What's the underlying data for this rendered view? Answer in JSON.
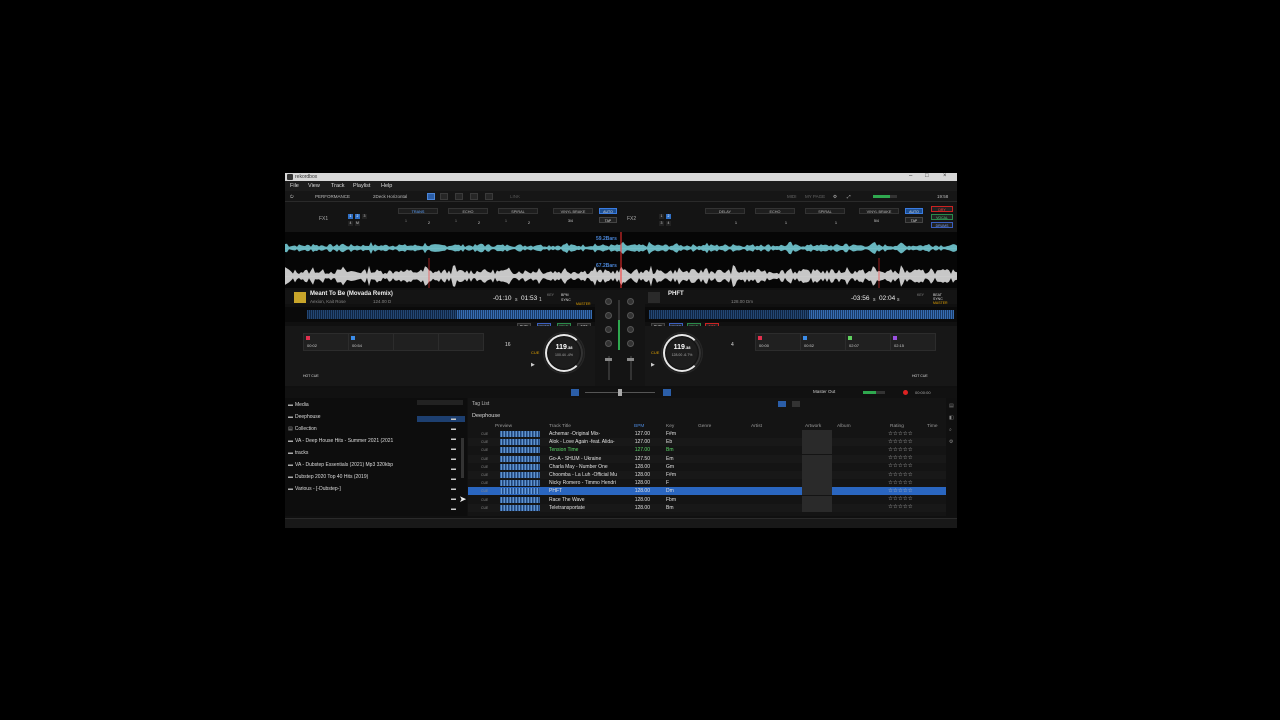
{
  "app": {
    "title": "rekordbox"
  },
  "menu": [
    "File",
    "View",
    "Track",
    "Playlist",
    "Help"
  ],
  "toolbar": {
    "mode": "PERFORMANCE",
    "layout": "2Deck Horizontal",
    "link": "LINK",
    "midi": "MIDI",
    "my_page": "MY PAGE",
    "clock": "19:58"
  },
  "fx": {
    "fx1_label": "FX1",
    "fx2_label": "FX2",
    "fx1_effects": [
      "TRANS",
      "ECHO",
      "SPIRAL"
    ],
    "fx2_effects": [
      "DELAY",
      "ECHO",
      "SPIRAL"
    ],
    "fx1_beats": [
      "LV",
      "BEAT",
      "LV",
      "BEAT",
      "LV",
      "BEAT"
    ],
    "vinyl_brake": "VINYL BRAKE",
    "auto": "AUTO",
    "tap": "TAP",
    "beat_frac_1": "3/4",
    "beat_frac_2": "5/4",
    "values_1": [
      "1",
      "2",
      "1",
      "2",
      "1",
      "2"
    ],
    "values_2": [
      "1",
      "1",
      "1",
      "1"
    ],
    "side_buttons": [
      "DRY",
      "VOCAL",
      "DRUMS"
    ]
  },
  "waveform": {
    "deck1_bars": "59.2Bars",
    "deck2_bars": "67.2Bars"
  },
  "deck1": {
    "title": "Meant To Be (Movada Remix)",
    "artist": "Aexion, Kait Rose",
    "bpm_key": "124.00  D",
    "remain": "-01:10",
    "remain_frac": "s",
    "elapsed": "01:53",
    "elapsed_frac": "1",
    "key_label": "KEY",
    "bpm_label": "BPM",
    "sync": "SYNC",
    "master": "MASTER",
    "tempo": "119",
    "tempo_dec": ".38",
    "tempo_sub": "100.44  -4%",
    "beat_jump": "16",
    "hot_cues": [
      {
        "time": "00:02",
        "color": "#e0304e"
      },
      {
        "time": "00:54",
        "color": "#3b8ce8"
      }
    ],
    "hot_cue_label": "HOT CUE",
    "stem_tags": [
      "MUTE",
      "DRUMS",
      "VOCAL",
      "INST"
    ]
  },
  "deck2": {
    "title": "PHFT",
    "artist": "",
    "bpm_key": "128.00  Dm",
    "remain": "-03:56",
    "remain_frac": "s",
    "elapsed": "02:04",
    "elapsed_frac": "s",
    "key_label": "KEY",
    "bpm_label": "BEAT",
    "sync": "SYNC",
    "master": "MASTER",
    "tempo": "119",
    "tempo_dec": ".38",
    "tempo_sub": "128.00  -6.7%",
    "beat_jump": "4",
    "hot_cues": [
      {
        "time": "00:00",
        "color": "#e0304e"
      },
      {
        "time": "00:52",
        "color": "#3b8ce8"
      },
      {
        "time": "02:07",
        "color": "#5fd05f"
      },
      {
        "time": "02:15",
        "color": "#9a50e0"
      }
    ],
    "hot_cue_label": "HOT CUE",
    "stem_tags": [
      "MUTE",
      "DRUMS",
      "VOCAL",
      "INST"
    ]
  },
  "mixer": {
    "master_out": "Master Out",
    "trim": "TRIM",
    "hi": "HIGH",
    "mid": "MID",
    "low": "LOW",
    "cfx": "CFX",
    "rec_time": "00:00:00"
  },
  "browser": {
    "tree": [
      {
        "label": "Media",
        "icon": "folder-icon"
      },
      {
        "label": "Deephouse",
        "icon": "folder-icon"
      },
      {
        "label": "Collection",
        "icon": "collection-icon"
      },
      {
        "label": "VA - Deep House Hits - Summer 2021 (2021",
        "icon": "folder-icon"
      },
      {
        "label": "tracks",
        "icon": "folder-icon"
      },
      {
        "label": "VA - Dubstep Essentials (2021) Mp3 320kbp",
        "icon": "folder-icon"
      },
      {
        "label": "Dubstep 2020 Top 40 Hits (2019)",
        "icon": "folder-icon"
      },
      {
        "label": "Various - [-Dubstep-]",
        "icon": "folder-icon"
      }
    ],
    "tag_list": "Tag List",
    "playlist_name": "Deephouse",
    "columns": [
      "Preview",
      "Track Title",
      "BPM",
      "Key",
      "Genre",
      "Artist",
      "Artwork",
      "Album",
      "Rating",
      "Time"
    ],
    "tracks": [
      {
        "title": "Achemar -Original Mix-",
        "bpm": "127.00",
        "key": "F#m",
        "highlight": false,
        "selected": false
      },
      {
        "title": "Alok - Love Again -feat. Alida-",
        "bpm": "127.00",
        "key": "Eb",
        "highlight": false,
        "selected": false
      },
      {
        "title": "Tension Time",
        "bpm": "127.00",
        "key": "Bm",
        "highlight": true,
        "selected": false
      },
      {
        "title": "Go-A - SHUM - Ukraine",
        "bpm": "127.50",
        "key": "Em",
        "highlight": false,
        "selected": false
      },
      {
        "title": "Charla May - Number One",
        "bpm": "128.00",
        "key": "Gm",
        "highlight": false,
        "selected": false
      },
      {
        "title": "Choomba - La Luh -Official Mu",
        "bpm": "128.00",
        "key": "F#m",
        "highlight": false,
        "selected": false
      },
      {
        "title": "Nicky Romero - Timmo Hendri",
        "bpm": "128.00",
        "key": "F",
        "highlight": false,
        "selected": false
      },
      {
        "title": "PHFT",
        "bpm": "128.00",
        "key": "Dm",
        "highlight": false,
        "selected": true
      },
      {
        "title": "Race The Wave",
        "bpm": "128.00",
        "key": "Fbm",
        "highlight": false,
        "selected": false
      },
      {
        "title": "Teletransportate",
        "bpm": "128.00",
        "key": "Bm",
        "highlight": false,
        "selected": false
      }
    ],
    "cue_badge": "CUE",
    "rating_stars": "☆☆☆☆☆"
  }
}
